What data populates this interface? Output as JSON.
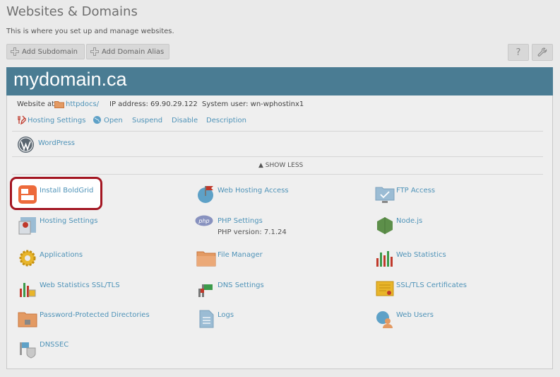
{
  "page": {
    "title": "Websites & Domains",
    "subtitle": "This is where you set up and manage websites."
  },
  "toolbar": {
    "add_subdomain": "Add Subdomain",
    "add_domain_alias": "Add Domain Alias",
    "help_icon": "?",
    "help_icon_name": "help-icon",
    "wrench_icon_name": "wrench-icon"
  },
  "domain": {
    "name": "mydomain.ca",
    "website_at_label": "Website at",
    "httpdocs": "httpdocs/",
    "ip_address": "IP address: 69.90.29.122",
    "system_user": "System user: wn-wphostinx1",
    "header_color": "#4a7c93"
  },
  "actions": {
    "hosting_settings": "Hosting Settings",
    "open": "Open",
    "suspend": "Suspend",
    "disable": "Disable",
    "description": "Description"
  },
  "wordpress": {
    "label": "WordPress"
  },
  "show_less": "SHOW LESS",
  "tools": [
    {
      "label": "Install BoldGrid",
      "icon": "boldgrid-icon"
    },
    {
      "label": "Web Hosting Access",
      "icon": "globe-flag-icon"
    },
    {
      "label": "FTP Access",
      "icon": "ftp-folder-icon"
    },
    {
      "label": "Hosting Settings",
      "icon": "hosting-settings-icon"
    },
    {
      "label": "PHP Settings",
      "icon": "php-icon",
      "sub": "PHP version: 7.1.24"
    },
    {
      "label": "Node.js",
      "icon": "nodejs-icon"
    },
    {
      "label": "Applications",
      "icon": "gear-icon"
    },
    {
      "label": "File Manager",
      "icon": "folder-icon"
    },
    {
      "label": "Web Statistics",
      "icon": "bar-chart-icon"
    },
    {
      "label": "Web Statistics SSL/TLS",
      "icon": "bar-chart-lock-icon"
    },
    {
      "label": "DNS Settings",
      "icon": "dns-flag-icon"
    },
    {
      "label": "SSL/TLS Certificates",
      "icon": "certificate-icon"
    },
    {
      "label": "Password-Protected Directories",
      "icon": "locked-folder-icon"
    },
    {
      "label": "Logs",
      "icon": "document-icon"
    },
    {
      "label": "Web Users",
      "icon": "web-users-icon"
    },
    {
      "label": "DNSSEC",
      "icon": "dnssec-icon"
    }
  ],
  "highlight_color": "#a31521"
}
